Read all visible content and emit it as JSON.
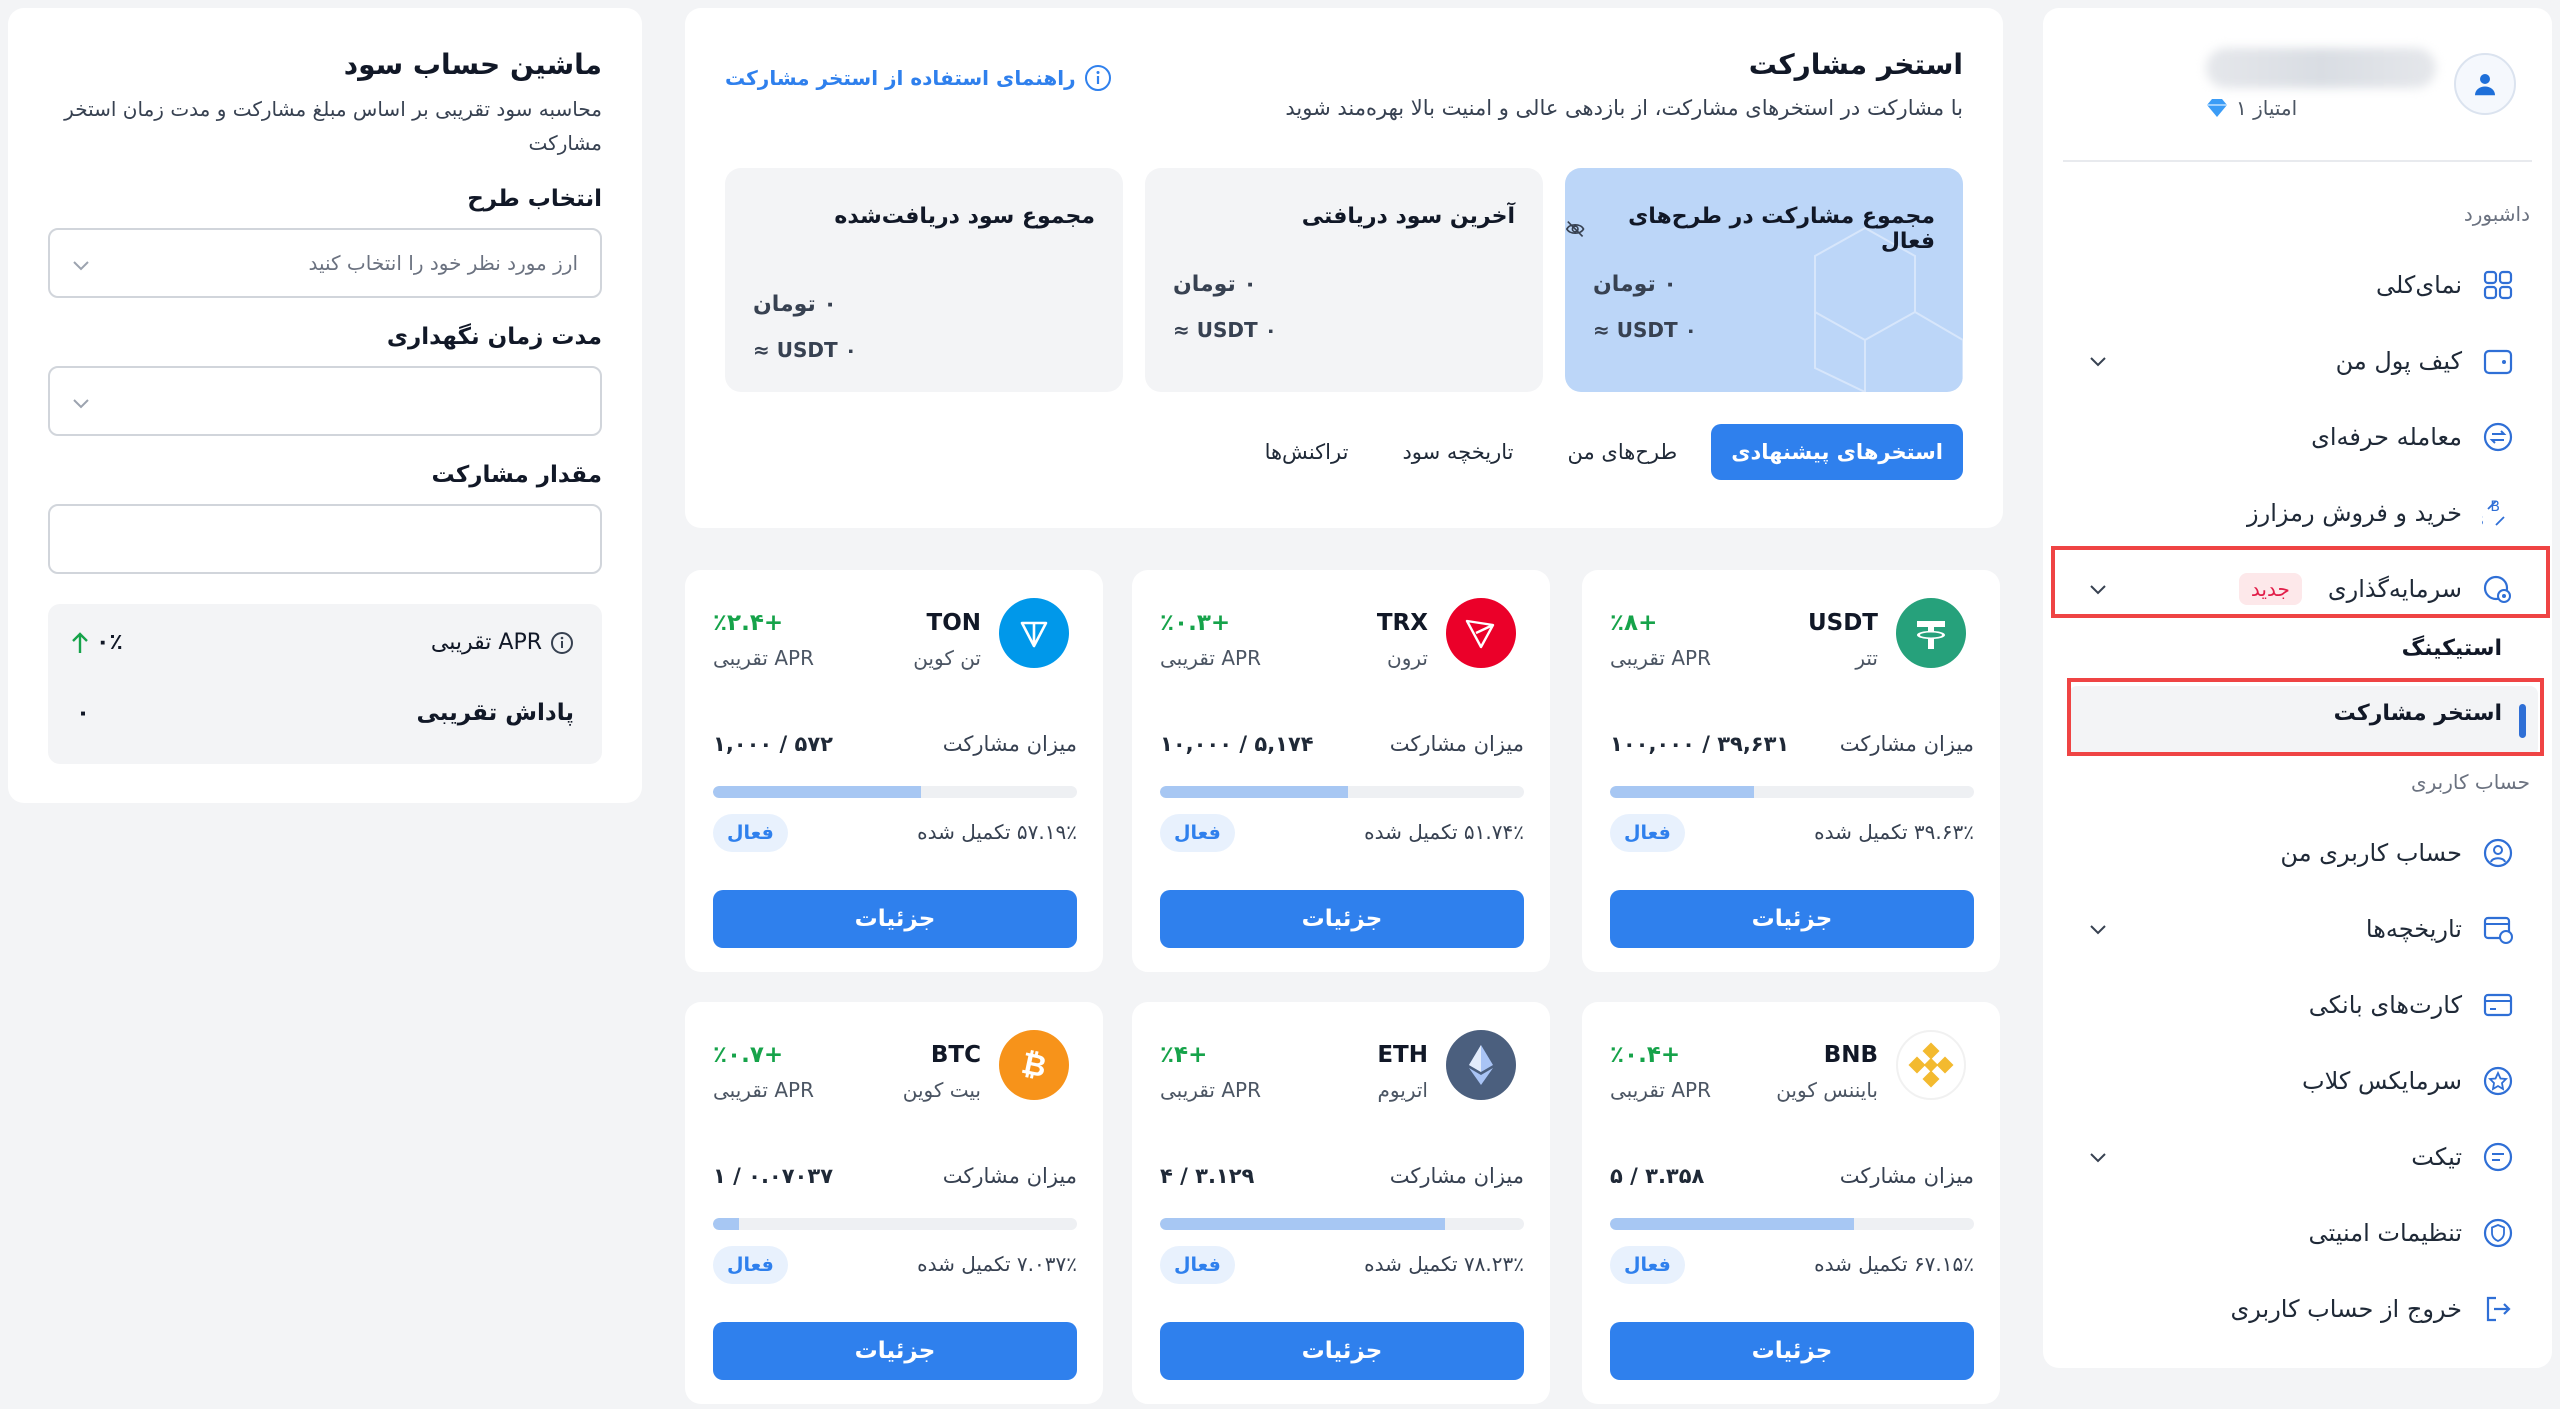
{
  "sidebar": {
    "user_points": "امتیاز ۱",
    "section_dashboard": "داشبورد",
    "items": [
      {
        "label": "نمای‌کلی"
      },
      {
        "label": "کیف پول من"
      },
      {
        "label": "معامله حرفه‌ای"
      },
      {
        "label": "خرید و فروش رمزارز"
      },
      {
        "label": "سرمایه‌گذاری"
      },
      {
        "label": "حساب کاربری من"
      },
      {
        "label": "تاریخچه‌ها"
      },
      {
        "label": "کارت‌های بانکی"
      },
      {
        "label": "سرمایکس کلاب"
      },
      {
        "label": "تیکت"
      },
      {
        "label": "تنظیمات امنیتی"
      },
      {
        "label": "خروج از حساب کاربری"
      }
    ],
    "new_badge": "جدید",
    "sub_items": [
      "استیکینگ",
      "استخر مشارکت"
    ],
    "section_account": "حساب کاربری"
  },
  "pool_header": {
    "title": "استخر مشارکت",
    "subtitle": "با مشارکت در استخرهای مشارکت، از بازدهی عالی و امنیت بالا بهره‌مند شوید",
    "guide_link": "راهنمای استفاده از استخر مشارکت",
    "stats": [
      {
        "title": "مجموع مشارکت در طرح‌های فعال",
        "toman": "۰ تومان",
        "usdt": "≈ USDT ۰"
      },
      {
        "title": "آخرین سود دریافتی",
        "toman": "۰ تومان",
        "usdt": "≈ USDT ۰"
      },
      {
        "title": "مجموع سود دریافت‌شده",
        "toman": "۰ تومان",
        "usdt": "≈ USDT ۰"
      }
    ],
    "tabs": [
      "استخرهای پیشنهادی",
      "طرح‌های من",
      "تاریخچه سود",
      "تراکنش‌ها"
    ]
  },
  "calculator": {
    "title": "ماشین حساب سود",
    "description": "محاسبه سود تقریبی بر اساس مبلغ مشارکت و مدت زمان استخر مشارکت",
    "plan_label": "انتخاب طرح",
    "plan_placeholder": "ارز مورد نظر خود را انتخاب کنید",
    "duration_label": "مدت زمان نگهداری",
    "amount_label": "مقدار مشارکت",
    "apr_label": "APR تقریبی",
    "apr_value": "۰٪",
    "reward_label": "پاداش تقریبی",
    "reward_value": "۰"
  },
  "pools": [
    {
      "symbol": "USDT",
      "name": "تتر",
      "apr": "+٪۸",
      "apr_label": "APR تقریبی",
      "participation_label": "میزان مشارکت",
      "participation": "۳۹,۶۳۱ / ۱۰۰,۰۰۰",
      "progress": 0.3963,
      "completed": "۳۹.۶۳٪ تکمیل شده",
      "status": "فعال",
      "button": "جزئیات",
      "color": "#26a17b"
    },
    {
      "symbol": "TRX",
      "name": "ترون",
      "apr": "+٪۰.۳",
      "apr_label": "APR تقریبی",
      "participation_label": "میزان مشارکت",
      "participation": "۵,۱۷۴ / ۱۰,۰۰۰",
      "progress": 0.5174,
      "completed": "۵۱.۷۴٪ تکمیل شده",
      "status": "فعال",
      "button": "جزئیات",
      "color": "#eb0029"
    },
    {
      "symbol": "TON",
      "name": "تن کوین",
      "apr": "+٪۲.۴",
      "apr_label": "APR تقریبی",
      "participation_label": "میزان مشارکت",
      "participation": "۵۷۲ / ۱,۰۰۰",
      "progress": 0.5719,
      "completed": "۵۷.۱۹٪ تکمیل شده",
      "status": "فعال",
      "button": "جزئیات",
      "color": "#0098ea"
    },
    {
      "symbol": "BNB",
      "name": "بایننس کوین",
      "apr": "+٪۰.۴",
      "apr_label": "APR تقریبی",
      "participation_label": "میزان مشارکت",
      "participation": "۳.۳۵۸ / ۵",
      "progress": 0.6715,
      "completed": "۶۷.۱۵٪ تکمیل شده",
      "status": "فعال",
      "button": "جزئیات",
      "color": "#f3ba2f"
    },
    {
      "symbol": "ETH",
      "name": "اتریوم",
      "apr": "+٪۴",
      "apr_label": "APR تقریبی",
      "participation_label": "میزان مشارکت",
      "participation": "۳.۱۲۹ / ۴",
      "progress": 0.7823,
      "completed": "۷۸.۲۳٪ تکمیل شده",
      "status": "فعال",
      "button": "جزئیات",
      "color": "#627eea"
    },
    {
      "symbol": "BTC",
      "name": "بیت کوین",
      "apr": "+٪۰.۷",
      "apr_label": "APR تقریبی",
      "participation_label": "میزان مشارکت",
      "participation": "۰.۰۷۰۳۷ / ۱",
      "progress": 0.0704,
      "completed": "۷.۰۳۷٪ تکمیل شده",
      "status": "فعال",
      "button": "جزئیات",
      "color": "#f7931a"
    }
  ]
}
